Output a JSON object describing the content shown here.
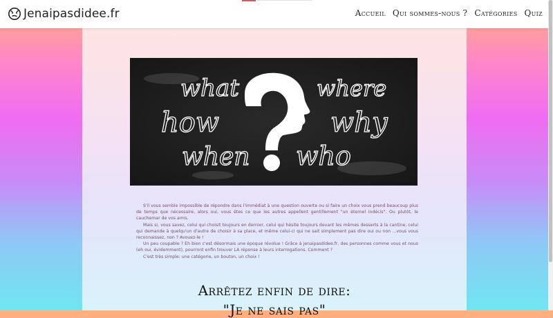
{
  "header": {
    "brand": "Jenaipasdidee.fr",
    "brand_icon": "face-icon",
    "nav": [
      "Accueil",
      "Qui sommes-nous ?",
      "Catégories",
      "Quiz"
    ]
  },
  "hero": {
    "words": [
      "what",
      "where",
      "how",
      "why",
      "when",
      "who"
    ],
    "center_glyph": "?"
  },
  "intro": {
    "paragraphs": [
      "S'il vous semble impossible de répondre dans l'immédiat à une question ouverte ou si faire un choix vous prend beaucoup plus de temps que nécessaire, alors oui, vous êtes ce que les autres appellent gentillement \"un éternel indécis\". Ou plutôt, le cauchemar de vos amis.",
      "Mais si, vous savez, celui qui choisit toujours en dernier, celui qui hésite toujours devant les mêmes desserts à la cantine, celui qui demande à quelqu'un d'autre de choisir à sa place, et même celui-ci qui ne sait simplement pas dire oui ou non ...vous vous reconnaissez, non ? Avouez-le !",
      "Un peu coupable ? Eh bien c'est désormais une époque révolue ! Grâce à jenaipasdidee.fr, des personnes comme vous et nous (eh oui, évidemment), pourront enfin trouver LA réponse à leurs interrogations. Comment ?",
      "C'est très simple: une catégorie, un bouton, un choix !"
    ]
  },
  "headline": {
    "line1": "Arrêtez enfin de dire:",
    "line2": "\"Je ne sais pas\""
  }
}
